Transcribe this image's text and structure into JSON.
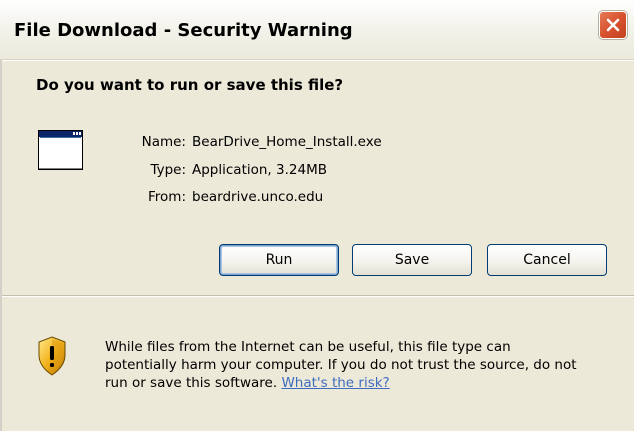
{
  "window": {
    "title": "File Download - Security Warning"
  },
  "dialog": {
    "question": "Do you want to run or save this file?",
    "file": {
      "name_label": "Name:",
      "name_value": "BearDrive_Home_Install.exe",
      "type_label": "Type:",
      "type_value": "Application, 3.24MB",
      "from_label": "From:",
      "from_value": "beardrive.unco.edu"
    },
    "buttons": {
      "run": "Run",
      "save": "Save",
      "cancel": "Cancel"
    },
    "warning": {
      "line1": "While files from the Internet can be useful, this file type can",
      "line2": "potentially harm your computer. If you do not trust the source, do not",
      "line3_prefix": "run or save this software.",
      "link": "What's the risk?"
    }
  },
  "icons": {
    "close": "close-icon",
    "application": "application-window-icon",
    "security": "security-shield-icon"
  },
  "colors": {
    "close_button": "#d8522f",
    "dialog_background": "#ece9d8",
    "link": "#3e6cc0",
    "button_border": "#003c74"
  }
}
